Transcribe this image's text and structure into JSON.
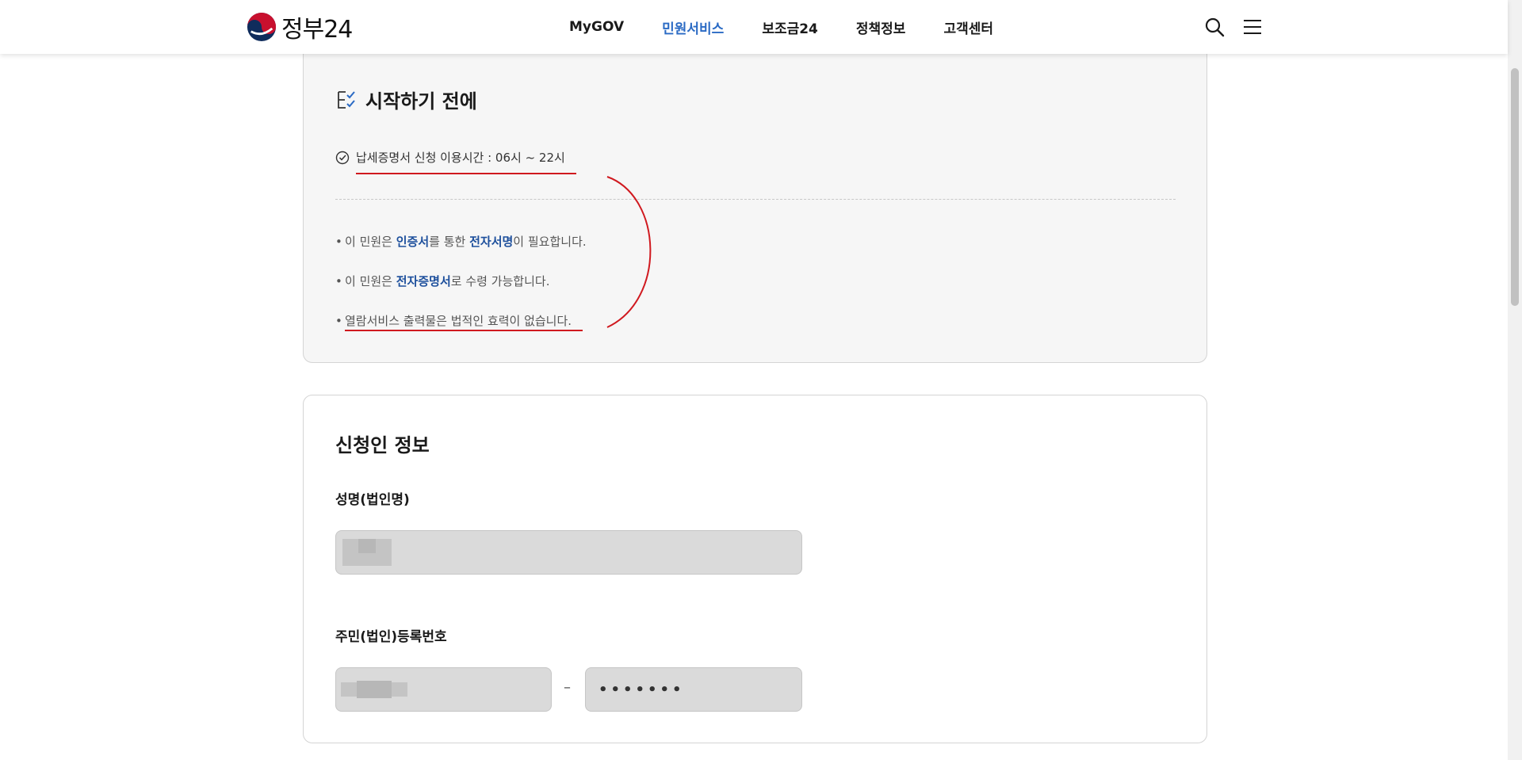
{
  "header": {
    "logo_text": "정부24",
    "nav": [
      "MyGOV",
      "민원서비스",
      "보조금24",
      "정책정보",
      "고객센터"
    ],
    "active_index": 1,
    "colors": {
      "active": "#2a6ac4",
      "accent_red": "#d0191f",
      "highlight": "#1d4f9c"
    }
  },
  "before_start": {
    "title": "시작하기 전에",
    "time_notice": "납세증명서 신청 이용시간 : 06시 ~ 22시",
    "notes": [
      {
        "pre": "이 민원은 ",
        "hl1": "인증서",
        "mid": "를 통한 ",
        "hl2": "전자서명",
        "post": "이 필요합니다."
      },
      {
        "pre": "이 민원은 ",
        "hl1": "전자증명서",
        "post": "로 수령 가능합니다."
      },
      {
        "text": "열람서비스 출력물은 법적인 효력이 없습니다."
      }
    ]
  },
  "applicant": {
    "title": "신청인 정보",
    "name_label": "성명(법인명)",
    "rrn_label": "주민(법인)등록번호",
    "rrn_separator": "–",
    "rrn_masked": "•••••••"
  }
}
